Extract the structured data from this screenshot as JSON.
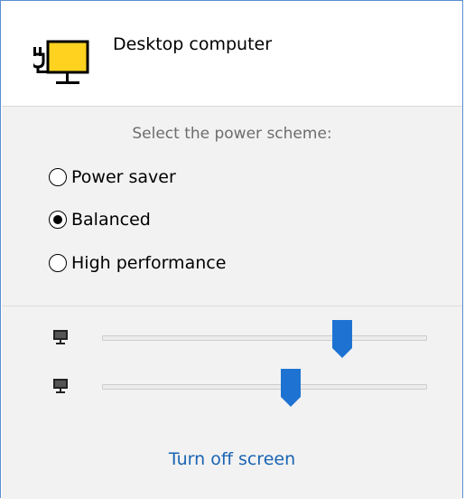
{
  "header": {
    "device_title": "Desktop computer",
    "icon": "desktop-plug-icon"
  },
  "scheme": {
    "label": "Select the power scheme:",
    "options": [
      {
        "label": "Power saver",
        "checked": false
      },
      {
        "label": "Balanced",
        "checked": true
      },
      {
        "label": "High performance",
        "checked": false
      }
    ]
  },
  "sliders": [
    {
      "icon": "monitor-icon",
      "value_fraction": 0.74
    },
    {
      "icon": "monitor-icon",
      "value_fraction": 0.58
    }
  ],
  "footer": {
    "turn_off_label": "Turn off screen"
  },
  "colors": {
    "accent": "#1e73d2",
    "link": "#1a64b3",
    "icon_yellow": "#ffd21f",
    "panel_bg": "#f2f2f2"
  }
}
